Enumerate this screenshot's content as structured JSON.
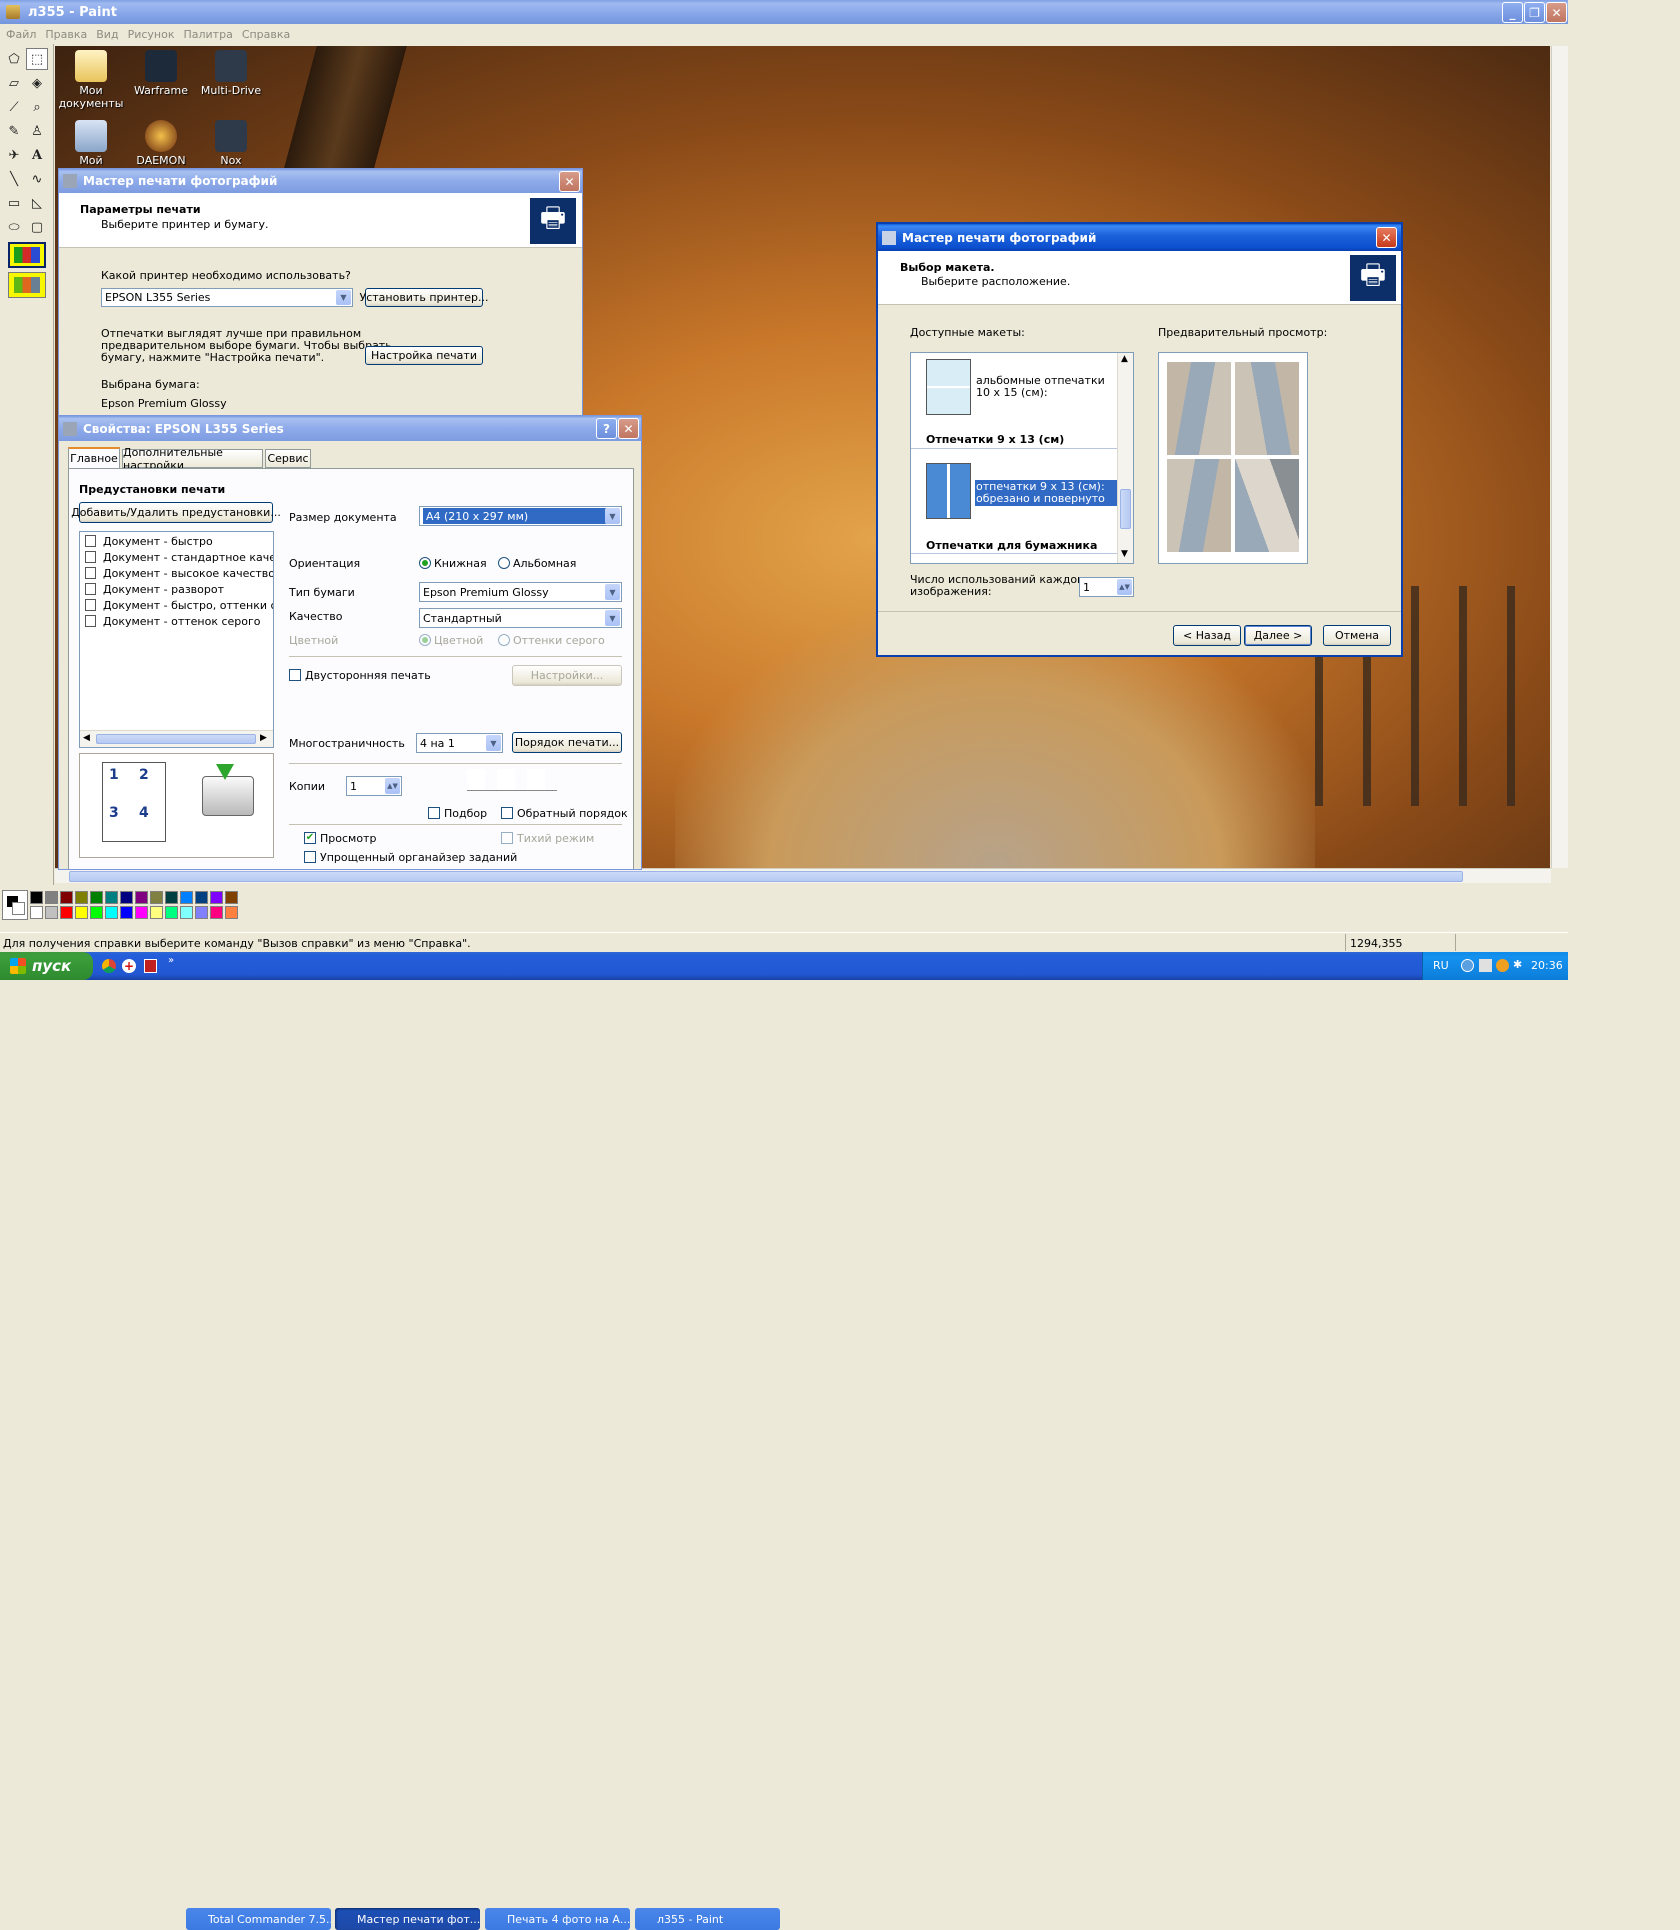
{
  "paint": {
    "title": "л355 - Paint",
    "menu": [
      "Файл",
      "Правка",
      "Вид",
      "Рисунок",
      "Палитра",
      "Справка"
    ],
    "status_text": "Для получения справки выберите команду \"Вызов справки\" из меню \"Справка\".",
    "coords": "1294,355",
    "tools": [
      "free-select-icon",
      "rect-select-icon",
      "eraser-icon",
      "fill-icon",
      "eyedropper-icon",
      "magnifier-icon",
      "pencil-icon",
      "brush-icon",
      "airbrush-icon",
      "text-icon",
      "line-icon",
      "curve-icon",
      "rectangle-icon",
      "polygon-icon",
      "ellipse-icon",
      "rounded-rect-icon"
    ],
    "palette_top": [
      "#000000",
      "#808080",
      "#800000",
      "#808000",
      "#008000",
      "#008080",
      "#000080",
      "#800080",
      "#808040",
      "#004040",
      "#0080ff",
      "#004080",
      "#8000ff",
      "#804000"
    ],
    "palette_bottom": [
      "#ffffff",
      "#c0c0c0",
      "#ff0000",
      "#ffff00",
      "#00ff00",
      "#00ffff",
      "#0000ff",
      "#ff00ff",
      "#ffff80",
      "#00ff80",
      "#80ffff",
      "#8080ff",
      "#ff0080",
      "#ff8040"
    ]
  },
  "desktop_icons": [
    {
      "label": "Мои документы"
    },
    {
      "label": "Warframe"
    },
    {
      "label": "Multi-Drive"
    },
    {
      "label": "Мой"
    },
    {
      "label": "DAEMON Tools"
    },
    {
      "label": "Nox"
    }
  ],
  "wizard1": {
    "title": "Мастер печати фотографий",
    "header_title": "Параметры печати",
    "header_sub": "Выберите принтер и бумагу.",
    "printer_question": "Какой принтер необходимо использовать?",
    "printer_value": "EPSON L355 Series",
    "install_button": "Установить принтер...",
    "info_line1": "Отпечатки выглядят лучше при правильном",
    "info_line2": "предварительном выборе бумаги. Чтобы выбрать",
    "info_line3": "бумагу, нажмите \"Настройка печати\".",
    "print_setup_button": "Настройка печати",
    "paper_label": "Выбрана бумага:",
    "paper_value": "Epson Premium Glossy"
  },
  "props": {
    "title": "Свойства: EPSON L355 Series",
    "tabs": [
      "Главное",
      "Дополнительные настройки",
      "Сервис"
    ],
    "presets_title": "Предустановки печати",
    "add_remove_button": "Добавить/Удалить предустановки...",
    "presets": [
      "Документ - быстро",
      "Документ - стандартное качество",
      "Документ - высокое качество",
      "Документ - разворот",
      "Документ - быстро, оттенки серого",
      "Документ - оттенок серого"
    ],
    "doc_size_label": "Размер документа",
    "doc_size_value": "A4 (210 x 297 мм)",
    "orientation_label": "Ориентация",
    "portrait": "Книжная",
    "landscape": "Альбомная",
    "paper_type_label": "Тип бумаги",
    "paper_type_value": "Epson Premium Glossy",
    "quality_label": "Качество",
    "quality_value": "Стандартный",
    "color_label": "Цветной",
    "color_opt": "Цветной",
    "gray_opt": "Оттенки серого",
    "duplex_label": "Двусторонняя печать",
    "settings_button": "Настройки...",
    "multipage_label": "Многостраничность",
    "multipage_value": "4 на 1",
    "print_order_button": "Порядок печати...",
    "copies_label": "Копии",
    "copies_value": "1",
    "collate_label": "Подбор",
    "reverse_label": "Обратный порядок",
    "preview_label": "Просмотр",
    "quiet_label": "Тихий режим",
    "simple_organizer_label": "Упрощенный органайзер заданий",
    "page_nums": [
      "1",
      "2",
      "3",
      "4"
    ]
  },
  "wizard2": {
    "title": "Мастер печати фотографий",
    "header_title": "Выбор макета.",
    "header_sub": "Выберите расположение.",
    "available_label": "Доступные макеты:",
    "preview_label": "Предварительный просмотр:",
    "layout1": "альбомные отпечатки 10 x 15 (см):",
    "group1": "Отпечатки 9 x 13 (см)",
    "layout2": "отпечатки 9 x 13 (см): обрезано и повернуто",
    "group2": "Отпечатки для бумажника",
    "uses_label_line1": "Число использований каждого",
    "uses_label_line2": "изображения:",
    "uses_value": "1",
    "back_button": "< Назад",
    "next_button": "Далее >",
    "cancel_button": "Отмена"
  },
  "taskbar": {
    "start": "пуск",
    "items": [
      "Total Commander 7.5...",
      "Мастер печати фот...",
      "Печать 4 фото на А...",
      "л355 - Paint"
    ],
    "lang": "RU",
    "clock": "20:36"
  }
}
